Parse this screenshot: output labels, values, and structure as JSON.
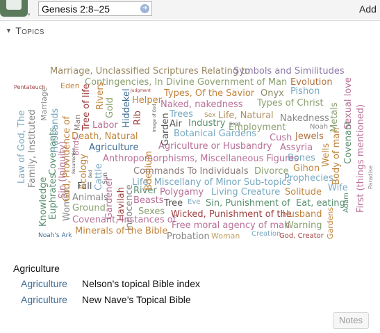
{
  "toolbar": {
    "reference_value": "Genesis 2:8–25",
    "add_label": "Add"
  },
  "section": {
    "title": "Topics"
  },
  "cloud_words": [
    "Marriage, Unclassified Scriptures Relating to",
    "Symbols and Similitudes",
    "Contingencies, In Divine Government of Man",
    "Evolution",
    "Pentateuch",
    "Eden",
    "Judgment",
    "Types, Of the Savior",
    "Onyx",
    "Pishon",
    "Naked, nakedness",
    "Types of Christ",
    "Helper",
    "Trees",
    "Sex",
    "Life, Natural",
    "Nakedness",
    "Air",
    "Industry",
    "Good",
    "Noah",
    "Labor",
    "Employment",
    "Botanical Gardens",
    "Cush",
    "Jewels",
    "Death, Natural",
    "Agriculture",
    "Agriculture or Husbandry",
    "Assyria",
    "Bones",
    "Anthropomorphisms, Miscellaneous Figures",
    "Commands To Individuals",
    "Divorce",
    "Gihon",
    "Prophecies",
    "Life, Miscellany of Minor Sub-topics",
    "Wife",
    "Fall",
    "Polygamy",
    "Living Creature",
    "Solitude",
    "Animals",
    "River",
    "Beasts",
    "Tree",
    "Eve",
    "Sin, Punishment of",
    "Eat, eating",
    "Ground",
    "Sexes",
    "Wicked, Punishment of the",
    "Husband",
    "Covenant, Instances of",
    "Free moral agency of man",
    "Warning",
    "Minerals of the Bible",
    "Probation",
    "Woman",
    "Creation",
    "God, Creator",
    "Noah's Ark",
    "Law of God, The",
    "Family, Instituted",
    "Knowledge",
    "Marriage",
    "Covenants",
    "Euphrates",
    "Sin (Iniquity)",
    "Women",
    "Husbands",
    "God, Providence of",
    "Man",
    "Birds",
    "Resurrection",
    "Ecology",
    "Tree of life",
    "Bed",
    "Cattle",
    "Rivers",
    "Gold",
    "Sun",
    "Gardener",
    "Havilah",
    "Hiddekel",
    "Innocence",
    "Rib",
    "Bdellium",
    "Image of God",
    "Garden",
    "Wells",
    "Body of man",
    "Metals",
    "Covenant",
    "Sexual love",
    "First (things mentioned)",
    "Paradise",
    "Gardens",
    "Adam"
  ],
  "colors": {
    "accent_link": "#3d6c96",
    "cloud_palette": [
      "#7a8fb8",
      "#b09060",
      "#8aa070",
      "#b87098",
      "#78a8c0",
      "#c0843c",
      "#a04040",
      "#5a9070",
      "#8c7aa8"
    ]
  },
  "selection": {
    "title": "Agriculture",
    "results": [
      {
        "topic": "Agriculture",
        "source": "Nelson's topical Bible index"
      },
      {
        "topic": "Agriculture",
        "source": "New Nave’s Topical Bible"
      }
    ]
  },
  "footer": {
    "notes_label": "Notes"
  },
  "icons": {
    "app": "book-icon",
    "go": "arrow-right-circle-icon",
    "collapse": "triangle-down-icon"
  }
}
